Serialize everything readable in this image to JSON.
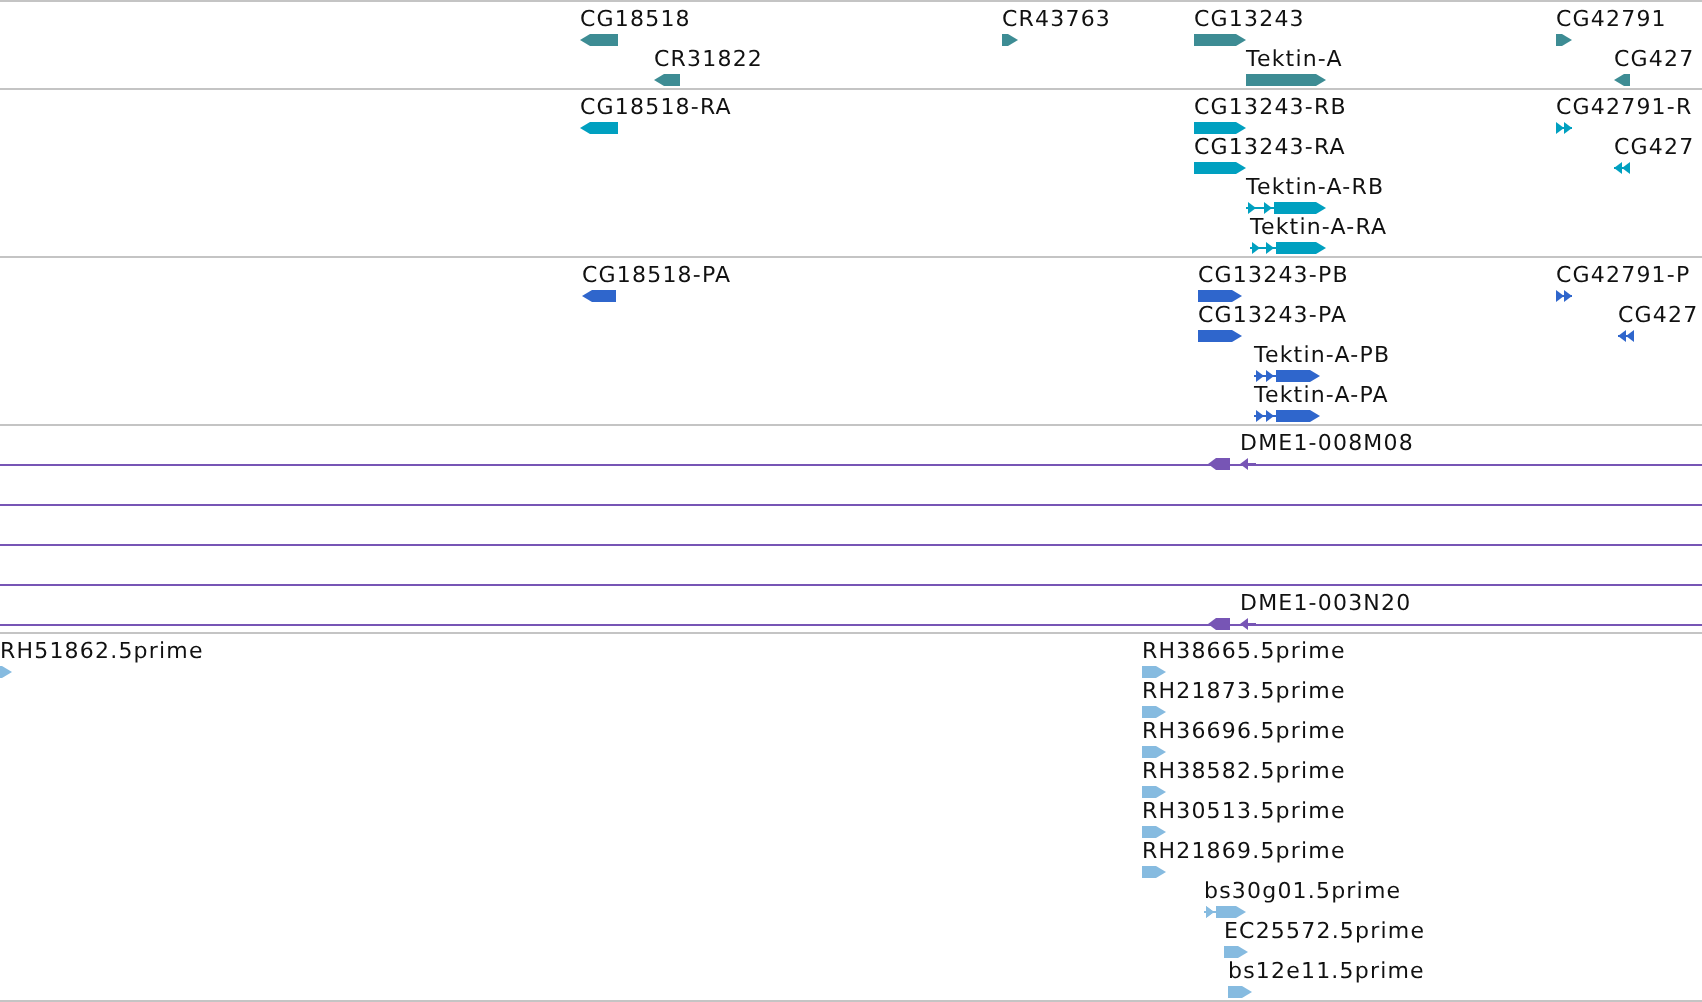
{
  "tracks": [
    {
      "kind": "genes",
      "color": "#3d8c94",
      "features": [
        {
          "label": "CG18518",
          "reverse": true,
          "kind": "block"
        },
        {
          "label": "CR31822",
          "reverse": true,
          "kind": "block"
        },
        {
          "label": "CR43763",
          "reverse": false,
          "kind": "block"
        },
        {
          "label": "CG13243",
          "reverse": false,
          "kind": "block"
        },
        {
          "label": "Tektin-A",
          "reverse": false,
          "kind": "block"
        },
        {
          "label": "CG42791",
          "reverse": false,
          "kind": "block"
        },
        {
          "label": "CG427",
          "reverse": true,
          "kind": "block"
        }
      ]
    },
    {
      "kind": "genes",
      "color": "#00a0c0",
      "features": [
        {
          "label": "CG18518-RA",
          "reverse": true,
          "kind": "block"
        },
        {
          "label": "CG13243-RB",
          "reverse": false,
          "kind": "block"
        },
        {
          "label": "CG13243-RA",
          "reverse": false,
          "kind": "block"
        },
        {
          "label": "Tektin-A-RB",
          "reverse": false,
          "kind": "split"
        },
        {
          "label": "Tektin-A-RA",
          "reverse": false,
          "kind": "split"
        },
        {
          "label": "CG42791-R",
          "reverse": false,
          "kind": "split"
        },
        {
          "label": "CG427",
          "reverse": true,
          "kind": "split"
        }
      ]
    },
    {
      "kind": "genes",
      "color": "#2f66cc",
      "features": [
        {
          "label": "CG18518-PA",
          "reverse": true,
          "kind": "block"
        },
        {
          "label": "CG13243-PB",
          "reverse": false,
          "kind": "block"
        },
        {
          "label": "CG13243-PA",
          "reverse": false,
          "kind": "block"
        },
        {
          "label": "Tektin-A-PB",
          "reverse": false,
          "kind": "split"
        },
        {
          "label": "Tektin-A-PA",
          "reverse": false,
          "kind": "split"
        },
        {
          "label": "CG42791-P",
          "reverse": false,
          "kind": "split"
        },
        {
          "label": "CG427",
          "reverse": true,
          "kind": "split"
        }
      ]
    },
    {
      "kind": "clones",
      "color": "#7755b5",
      "features": [
        {
          "label": "DME1-008M08",
          "marker": true
        },
        {
          "marker": false
        },
        {
          "marker": false
        },
        {
          "marker": false
        },
        {
          "label": "DME1-003N20",
          "marker": true
        }
      ]
    },
    {
      "kind": "genes",
      "color": "#86bbe0",
      "features": [
        {
          "label": "RH51862.5prime",
          "reverse": false,
          "kind": "block"
        },
        {
          "label": "RH38665.5prime",
          "reverse": false,
          "kind": "block"
        },
        {
          "label": "RH21873.5prime",
          "reverse": false,
          "kind": "block"
        },
        {
          "label": "RH36696.5prime",
          "reverse": false,
          "kind": "block"
        },
        {
          "label": "RH38582.5prime",
          "reverse": false,
          "kind": "block"
        },
        {
          "label": "RH30513.5prime",
          "reverse": false,
          "kind": "block"
        },
        {
          "label": "RH21869.5prime",
          "reverse": false,
          "kind": "block"
        },
        {
          "label": "bs30g01.5prime",
          "reverse": false,
          "kind": "split"
        },
        {
          "label": "EC25572.5prime",
          "reverse": false,
          "kind": "block"
        },
        {
          "label": "bs12e11.5prime",
          "reverse": false,
          "kind": "block"
        }
      ]
    }
  ]
}
